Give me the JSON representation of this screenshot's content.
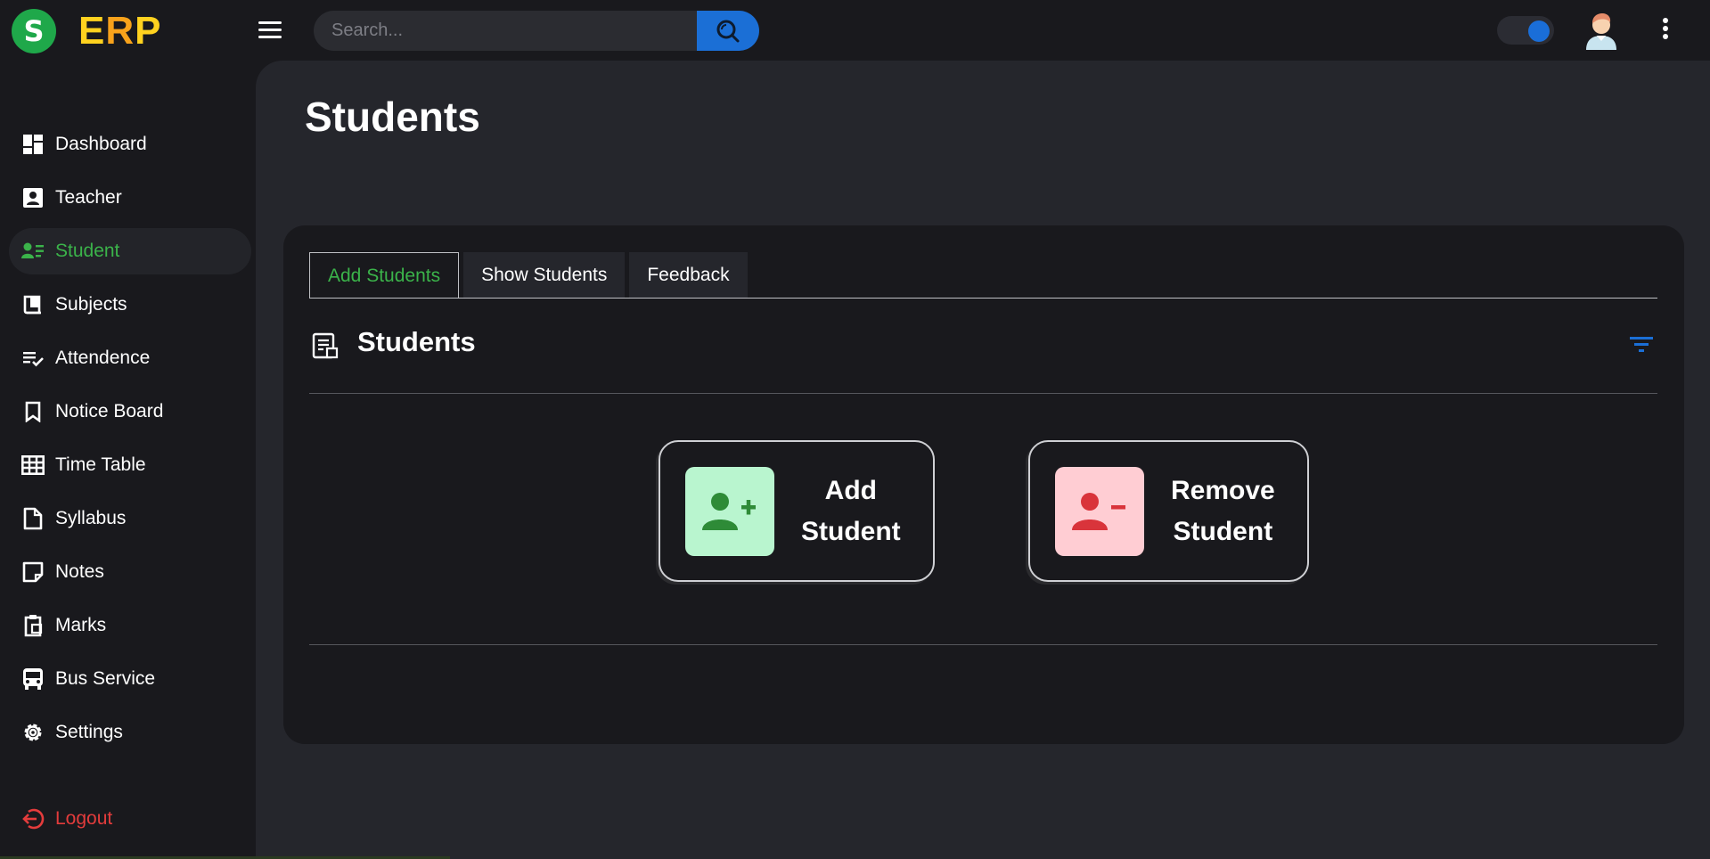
{
  "brand": {
    "logo_letter": "S",
    "e": "E",
    "r": "R",
    "p": "P"
  },
  "search": {
    "placeholder": "Search..."
  },
  "sidebar": {
    "items": [
      {
        "label": "Dashboard",
        "icon": "dashboard-icon"
      },
      {
        "label": "Teacher",
        "icon": "teacher-icon"
      },
      {
        "label": "Student",
        "icon": "student-icon",
        "active": true
      },
      {
        "label": "Subjects",
        "icon": "book-icon"
      },
      {
        "label": "Attendence",
        "icon": "checklist-icon"
      },
      {
        "label": "Notice Board",
        "icon": "bookmark-icon"
      },
      {
        "label": "Time Table",
        "icon": "grid-icon"
      },
      {
        "label": "Syllabus",
        "icon": "document-icon"
      },
      {
        "label": "Notes",
        "icon": "note-icon"
      },
      {
        "label": "Marks",
        "icon": "clipboard-icon"
      },
      {
        "label": "Bus Service",
        "icon": "bus-icon"
      },
      {
        "label": "Settings",
        "icon": "gear-icon"
      }
    ],
    "logout": "Logout"
  },
  "page": {
    "title": "Students"
  },
  "tabs": [
    {
      "label": "Add Students",
      "active": true
    },
    {
      "label": "Show Students"
    },
    {
      "label": "Feedback"
    }
  ],
  "section": {
    "title": "Students"
  },
  "actions": {
    "add": {
      "line1": "Add",
      "line2": "Student"
    },
    "remove": {
      "line1": "Remove",
      "line2": "Student"
    }
  },
  "colors": {
    "accent_blue": "#1b6fd6",
    "active_green": "#3bb34a",
    "logout_red": "#e43c3c",
    "brand_yellow": "#ffd21f"
  }
}
